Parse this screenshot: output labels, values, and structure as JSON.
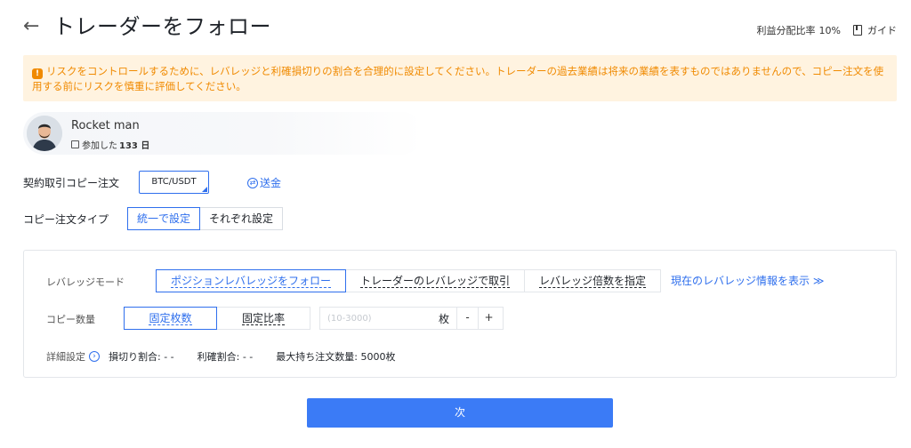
{
  "header": {
    "title": "トレーダーをフォロー",
    "profit_share_label": "利益分配比率",
    "profit_share_value": "10%",
    "guide_label": "ガイド"
  },
  "warning": {
    "text": "リスクをコントロールするために、レバレッジと利確損切りの割合を合理的に設定してください。トレーダーの過去業績は将来の業績を表すものではありませんので、コピー注文を使用する前にリスクを慎重に評価してください。",
    "icon": "warning-shield-icon"
  },
  "trader": {
    "name": "Rocket man",
    "joined_label": "参加した",
    "joined_days": "133 日"
  },
  "contract": {
    "label": "契約取引コピー注文",
    "pair": "BTC/USDT",
    "transfer_label": "送金"
  },
  "copy_type": {
    "label": "コピー注文タイプ",
    "options": [
      "統一で設定",
      "それぞれ設定"
    ],
    "selected_index": 0
  },
  "leverage": {
    "label": "レバレッジモード",
    "options": [
      "ポジションレバレッジをフォロー",
      "トレーダーのレバレッジで取引",
      "レバレッジ倍数を指定"
    ],
    "selected_index": 0,
    "view_link": "現在のレバレッジ情報を表示 ≫"
  },
  "quantity": {
    "label": "コピー数量",
    "options": [
      "固定枚数",
      "固定比率"
    ],
    "selected_index": 0,
    "input_placeholder": "(10-3000)",
    "input_value": "",
    "unit": "枚",
    "decrement": "-",
    "increment": "+"
  },
  "details": {
    "label": "詳細設定",
    "stop_loss": "損切り割合: - -",
    "take_profit": "利確割合: - -",
    "max_orders": "最大持ち注文数量: 5000枚"
  },
  "next_button": "次",
  "colors": {
    "accent": "#2f6fed",
    "button": "#3b7bf6",
    "warning_bg": "#fff3e0",
    "warning_text": "#f08a00"
  }
}
